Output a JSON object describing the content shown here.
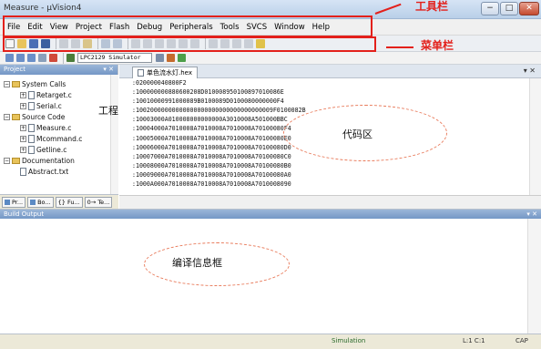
{
  "window": {
    "title": "Measure - µVision4",
    "controls": [
      "−",
      "□",
      "✕"
    ]
  },
  "menubar": {
    "items": [
      "File",
      "Edit",
      "View",
      "Project",
      "Flash",
      "Debug",
      "Peripherals",
      "Tools",
      "SVCS",
      "Window",
      "Help"
    ]
  },
  "toolbar": {
    "target_select": "LPC2129 Simulator"
  },
  "annotations": {
    "toolbar_label": "工具栏",
    "menubar_label": "菜单栏",
    "project_label": "工程区",
    "code_label": "代码区",
    "build_label": "编译信息框",
    "accent_color": "#e3201b"
  },
  "project_pane": {
    "title": "Project",
    "tree": [
      {
        "label": "System Calls",
        "type": "folder",
        "expanded": true
      },
      {
        "label": "Retarget.c",
        "type": "file"
      },
      {
        "label": "Serial.c",
        "type": "file"
      },
      {
        "label": "Source Code",
        "type": "folder",
        "expanded": true
      },
      {
        "label": "Measure.c",
        "type": "file"
      },
      {
        "label": "Mcommand.c",
        "type": "file"
      },
      {
        "label": "Getline.c",
        "type": "file"
      },
      {
        "label": "Documentation",
        "type": "folder",
        "expanded": true
      },
      {
        "label": "Abstract.txt",
        "type": "file"
      }
    ],
    "tabs": [
      "Pr...",
      "Bo...",
      "{} Fu...",
      "0→ Te..."
    ]
  },
  "editor": {
    "tab_label": "单色流水灯.hex",
    "lines": [
      ":020000040800F2",
      ":100000000880600208D010008950100897010086E",
      ":10010000991000089B0100089D0100080000000F4",
      ":10020000000000000000000000000000000009F0100082B",
      ":10003000A010008000000000A3010008A501000BBC",
      ":10004000A7010008A7010008A7010008A70100080F4",
      ":10005000A7010008A7010008A7010008A70100080E0",
      ":10006000A7010008A7010008A7010008A70100080D0",
      ":10007000A7010008A7010008A7010008A70100080C0",
      ":10008000A7010008A7010008A7010008A70100080B0",
      ":10009000A7010008A7010008A7010008A70100080A0",
      ":1000A000A7010008A7010008A7010008A7010008090"
    ]
  },
  "build_output": {
    "title": "Build Output"
  },
  "statusbar": {
    "mode": "Simulation",
    "position": "L:1 C:1",
    "caps": "CAP"
  }
}
